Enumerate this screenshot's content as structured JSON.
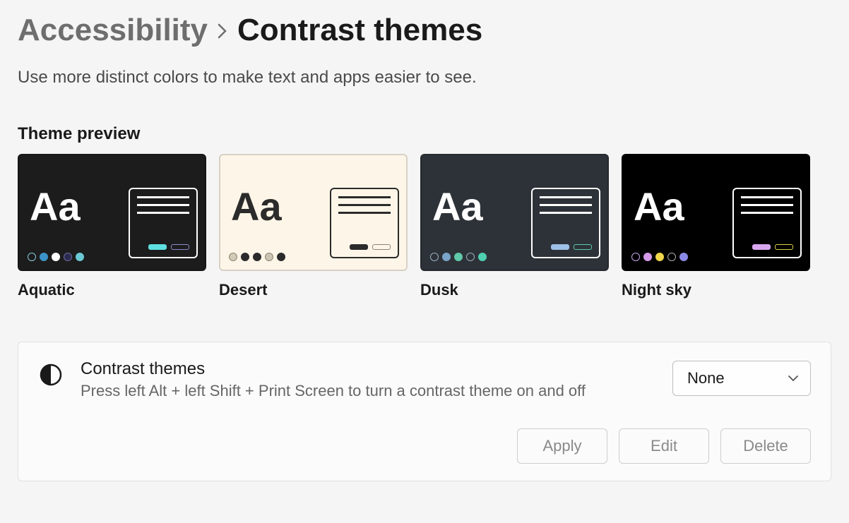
{
  "breadcrumb": {
    "parent": "Accessibility",
    "current": "Contrast themes"
  },
  "description": "Use more distinct colors to make text and apps easier to see.",
  "section_heading": "Theme preview",
  "themes": [
    {
      "name": "Aquatic",
      "bg": "#1c1c1c",
      "text": "#ffffff",
      "box_border": "#ffffff",
      "line": "#ffffff",
      "dots": [
        {
          "bg": "transparent",
          "border": "#8ac7db"
        },
        {
          "bg": "#3b93c9",
          "border": "#3b93c9"
        },
        {
          "bg": "#ffffff",
          "border": "#ffffff"
        },
        {
          "bg": "#2b2b50",
          "border": "#6a6aa0"
        },
        {
          "bg": "#6bc9d4",
          "border": "#6bc9d4"
        }
      ],
      "btns": [
        {
          "bg": "#5ee0e0",
          "border": "#5ee0e0"
        },
        {
          "bg": "transparent",
          "border": "#8a8ad0"
        }
      ]
    },
    {
      "name": "Desert",
      "bg": "#fdf6e8",
      "text": "#2b2b2b",
      "box_border": "#2b2b2b",
      "line": "#2b2b2b",
      "dots": [
        {
          "bg": "#d3cbb8",
          "border": "#8a8470"
        },
        {
          "bg": "#2b2b2b",
          "border": "#2b2b2b"
        },
        {
          "bg": "#2b2b2b",
          "border": "#2b2b2b"
        },
        {
          "bg": "#cbc4b4",
          "border": "#8a8470"
        },
        {
          "bg": "#2b2b2b",
          "border": "#2b2b2b"
        }
      ],
      "btns": [
        {
          "bg": "#2b2b2b",
          "border": "#2b2b2b"
        },
        {
          "bg": "transparent",
          "border": "#8a8470"
        }
      ]
    },
    {
      "name": "Dusk",
      "bg": "#2d3238",
      "text": "#ffffff",
      "box_border": "#ffffff",
      "line": "#ffffff",
      "dots": [
        {
          "bg": "transparent",
          "border": "#9aaec0"
        },
        {
          "bg": "#7aa4c9",
          "border": "#7aa4c9"
        },
        {
          "bg": "#5fc9a8",
          "border": "#5fc9a8"
        },
        {
          "bg": "transparent",
          "border": "#9aaec0"
        },
        {
          "bg": "#4fd0b0",
          "border": "#4fd0b0"
        }
      ],
      "btns": [
        {
          "bg": "#9dc1e8",
          "border": "#9dc1e8"
        },
        {
          "bg": "transparent",
          "border": "#5fc9a8"
        }
      ]
    },
    {
      "name": "Night sky",
      "bg": "#000000",
      "text": "#ffffff",
      "box_border": "#ffffff",
      "line": "#ffffff",
      "dots": [
        {
          "bg": "transparent",
          "border": "#c3a6e8"
        },
        {
          "bg": "#d49ae8",
          "border": "#d49ae8"
        },
        {
          "bg": "#f0d64a",
          "border": "#f0d64a"
        },
        {
          "bg": "transparent",
          "border": "#aaaaaa"
        },
        {
          "bg": "#8a8ae6",
          "border": "#8a8ae6"
        }
      ],
      "btns": [
        {
          "bg": "#d9a6f0",
          "border": "#d9a6f0"
        },
        {
          "bg": "transparent",
          "border": "#d9cf4a"
        }
      ]
    }
  ],
  "card": {
    "title": "Contrast themes",
    "subtitle": "Press left Alt + left Shift + Print Screen to turn a contrast theme on and off",
    "dropdown_value": "None",
    "apply_label": "Apply",
    "edit_label": "Edit",
    "delete_label": "Delete"
  }
}
